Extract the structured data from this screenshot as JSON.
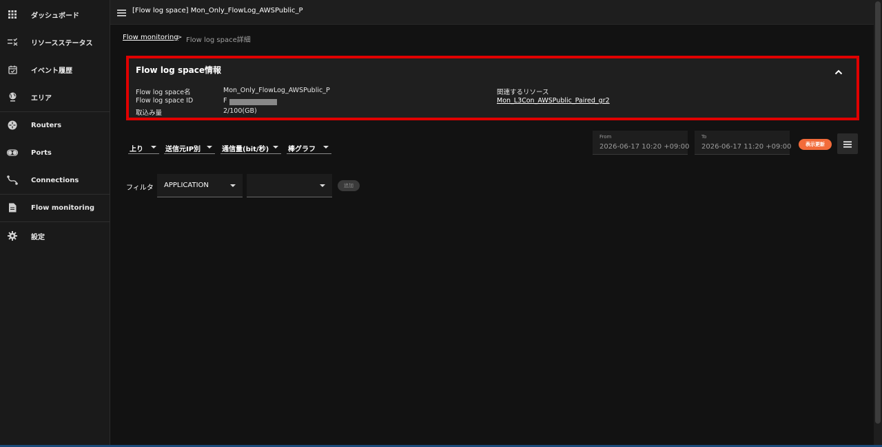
{
  "sidebar": {
    "items": [
      {
        "label": "ダッシュボード",
        "icon": "grid-icon"
      },
      {
        "label": "リソースステータス",
        "icon": "list-check-icon"
      },
      {
        "label": "イベント履歴",
        "icon": "calendar-check-icon"
      },
      {
        "label": "エリア",
        "icon": "globe-icon"
      },
      {
        "label": "Routers",
        "icon": "router-icon"
      },
      {
        "label": "Ports",
        "icon": "ports-toggle-icon"
      },
      {
        "label": "Connections",
        "icon": "connection-icon"
      },
      {
        "label": "Flow monitoring",
        "icon": "document-icon"
      },
      {
        "label": "設定",
        "icon": "gear-icon"
      }
    ]
  },
  "header": {
    "title": "[Flow log space] Mon_Only_FlowLog_AWSPublic_P"
  },
  "breadcrumb": {
    "parent": "Flow monitoring",
    "separator": ">",
    "current": "Flow log space詳細"
  },
  "info_card": {
    "title": "Flow log space情報",
    "name_label": "Flow log space名",
    "name_value": "Mon_Only_FlowLog_AWSPublic_P",
    "id_label": "Flow log space ID",
    "id_value": "F",
    "usage_label": "取込み量",
    "usage_value": "2/100(GB)",
    "related_label": "関連するリソース",
    "related_value": "Mon_L3Con_AWSPublic_Paired_gr2"
  },
  "controls": {
    "direction": "上り",
    "group_by": "送信元IP別",
    "metric": "通信量(bit/秒)",
    "chart_type": "棒グラフ",
    "from_label": "From",
    "from_value": "2026-06-17 10:20 +09:00",
    "to_label": "To",
    "to_value": "2026-06-17 11:20 +09:00",
    "refresh_label": "表示更新"
  },
  "filter": {
    "label": "フィルタ",
    "field_value": "APPLICATION",
    "condition_value": "",
    "add_label": "追加"
  },
  "colors": {
    "highlight_border": "#e00000",
    "refresh_button": "#f26b3a",
    "background": "#121212"
  }
}
